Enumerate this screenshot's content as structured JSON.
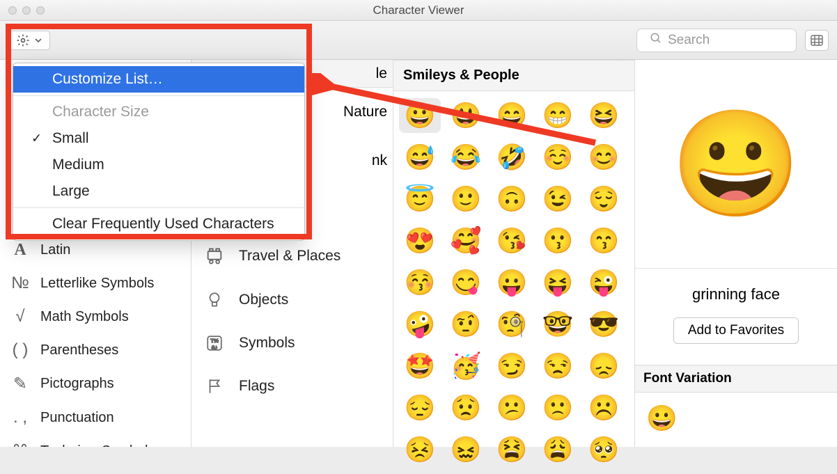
{
  "window": {
    "title": "Character Viewer"
  },
  "search": {
    "placeholder": "Search"
  },
  "dropdown": {
    "customize": "Customize List…",
    "size_label": "Character Size",
    "small": "Small",
    "medium": "Medium",
    "large": "Large",
    "clear": "Clear Frequently Used Characters"
  },
  "sidebar1": {
    "items": [
      {
        "icon": "A",
        "label": "Latin"
      },
      {
        "icon": "№",
        "label": "Letterlike Symbols"
      },
      {
        "icon": "√",
        "label": "Math Symbols"
      },
      {
        "icon": "()",
        "label": "Parentheses"
      },
      {
        "icon": "✎",
        "label": "Pictographs"
      },
      {
        "icon": ".,",
        "label": "Punctuation"
      },
      {
        "icon": "⌘",
        "label": "Technic…Symbols"
      }
    ]
  },
  "sidebar2": {
    "peek1": "le",
    "peek2": "Nature",
    "peek3": "nk",
    "items": [
      {
        "icon": "travel",
        "label": "Travel & Places"
      },
      {
        "icon": "bulb",
        "label": "Objects"
      },
      {
        "icon": "symbols",
        "label": "Symbols"
      },
      {
        "icon": "flag",
        "label": "Flags"
      }
    ]
  },
  "grid": {
    "header": "Smileys & People",
    "emojis": [
      "😀",
      "😃",
      "😄",
      "😁",
      "😆",
      "😅",
      "😂",
      "🤣",
      "☺️",
      "😊",
      "😇",
      "🙂",
      "🙃",
      "😉",
      "😌",
      "😍",
      "🥰",
      "😘",
      "😗",
      "😙",
      "😚",
      "😋",
      "😛",
      "😝",
      "😜",
      "🤪",
      "🤨",
      "🧐",
      "🤓",
      "😎",
      "🤩",
      "🥳",
      "😏",
      "😒",
      "😞",
      "😔",
      "😟",
      "😕",
      "🙁",
      "☹️",
      "😣",
      "😖",
      "😫",
      "😩",
      "🥺"
    ],
    "selected_index": 0
  },
  "detail": {
    "name": "grinning face",
    "favorites_btn": "Add to Favorites",
    "variation_header": "Font Variation",
    "variation_emoji": "😀",
    "preview_emoji": "😀"
  }
}
